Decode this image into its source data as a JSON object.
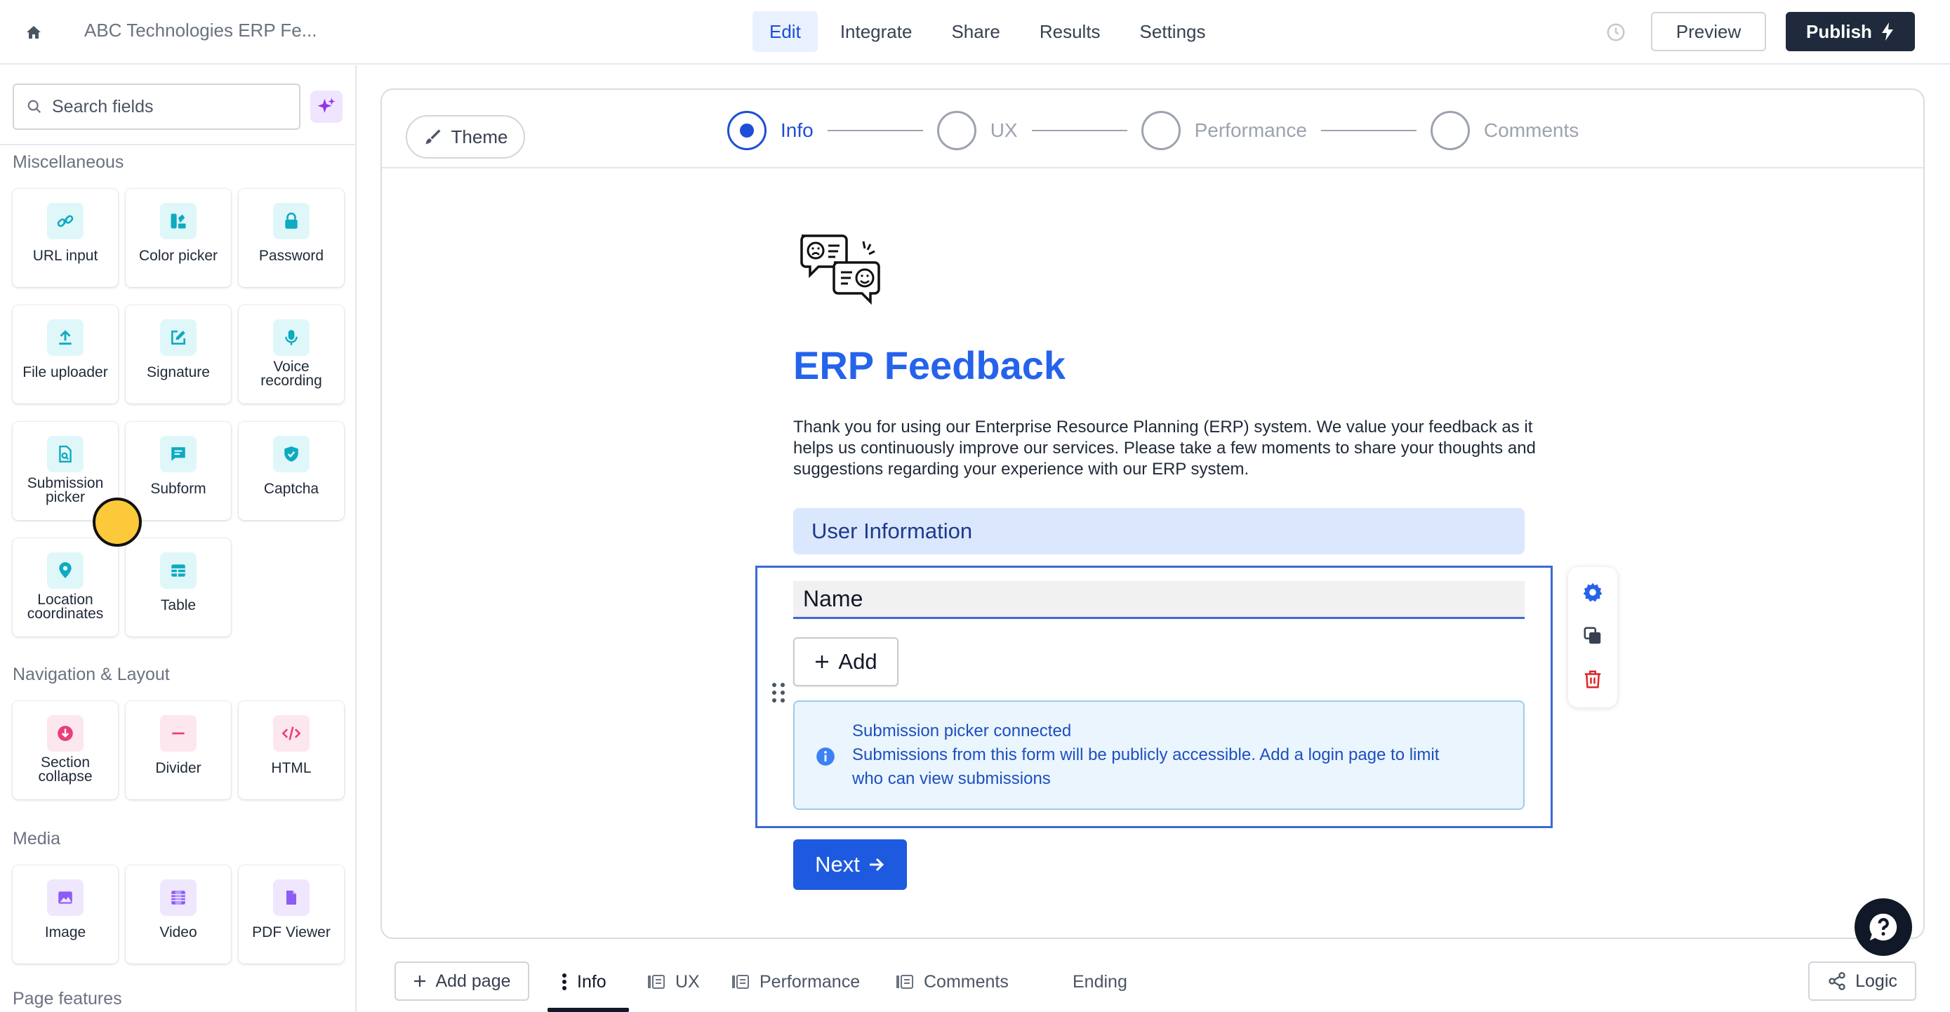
{
  "topbar": {
    "form_title": "ABC Technologies ERP Fe...",
    "tabs": [
      {
        "label": "Edit",
        "active": true
      },
      {
        "label": "Integrate",
        "active": false
      },
      {
        "label": "Share",
        "active": false
      },
      {
        "label": "Results",
        "active": false
      },
      {
        "label": "Settings",
        "active": false
      }
    ],
    "preview_label": "Preview",
    "publish_label": "Publish",
    "accent_color": "#1d4ed8",
    "publish_bg": "#1f2a3d"
  },
  "sidebar": {
    "search_placeholder": "Search fields",
    "sections": [
      {
        "title": "Miscellaneous",
        "items": [
          {
            "label": "URL input",
            "icon": "link-icon"
          },
          {
            "label": "Color picker",
            "icon": "palette-icon"
          },
          {
            "label": "Password",
            "icon": "lock-icon"
          },
          {
            "label": "File uploader",
            "icon": "upload-icon"
          },
          {
            "label": "Signature",
            "icon": "pen-square-icon"
          },
          {
            "label": "Voice recording",
            "icon": "microphone-icon"
          },
          {
            "label": "Submission picker",
            "icon": "file-search-icon"
          },
          {
            "label": "Subform",
            "icon": "message-square-icon"
          },
          {
            "label": "Captcha",
            "icon": "shield-check-icon"
          },
          {
            "label": "Location coordinates",
            "icon": "map-pin-icon"
          },
          {
            "label": "Table",
            "icon": "table-icon"
          }
        ]
      },
      {
        "title": "Navigation & Layout",
        "items": [
          {
            "label": "Section collapse",
            "icon": "circle-arrow-down-icon"
          },
          {
            "label": "Divider",
            "icon": "minus-icon"
          },
          {
            "label": "HTML",
            "icon": "code-icon"
          }
        ]
      },
      {
        "title": "Media",
        "items": [
          {
            "label": "Image",
            "icon": "image-icon"
          },
          {
            "label": "Video",
            "icon": "film-icon"
          },
          {
            "label": "PDF Viewer",
            "icon": "file-icon"
          }
        ]
      },
      {
        "title": "Page features",
        "items": []
      }
    ]
  },
  "canvas": {
    "theme_label": "Theme",
    "steps": [
      {
        "label": "Info",
        "active": true
      },
      {
        "label": "UX",
        "active": false
      },
      {
        "label": "Performance",
        "active": false
      },
      {
        "label": "Comments",
        "active": false
      }
    ],
    "form": {
      "heading": "ERP Feedback",
      "description": "Thank you for using our Enterprise Resource Planning (ERP) system. We value your feedback as it helps us continuously improve our services. Please take a few moments to share your thoughts and suggestions regarding your experience with our ERP system.",
      "section_title": "User Information",
      "field_label": "Name",
      "add_label": "Add",
      "info_title": "Submission picker connected",
      "info_line1": "Submissions from this form will be publicly accessible. Add a login page to limit",
      "info_line2": "who can view submissions",
      "next_label": "Next"
    }
  },
  "bottombar": {
    "add_page_label": "Add page",
    "pages": [
      {
        "label": "Info",
        "active": true
      },
      {
        "label": "UX",
        "active": false
      },
      {
        "label": "Performance",
        "active": false
      },
      {
        "label": "Comments",
        "active": false
      },
      {
        "label": "Ending",
        "active": false
      }
    ],
    "logic_label": "Logic"
  }
}
